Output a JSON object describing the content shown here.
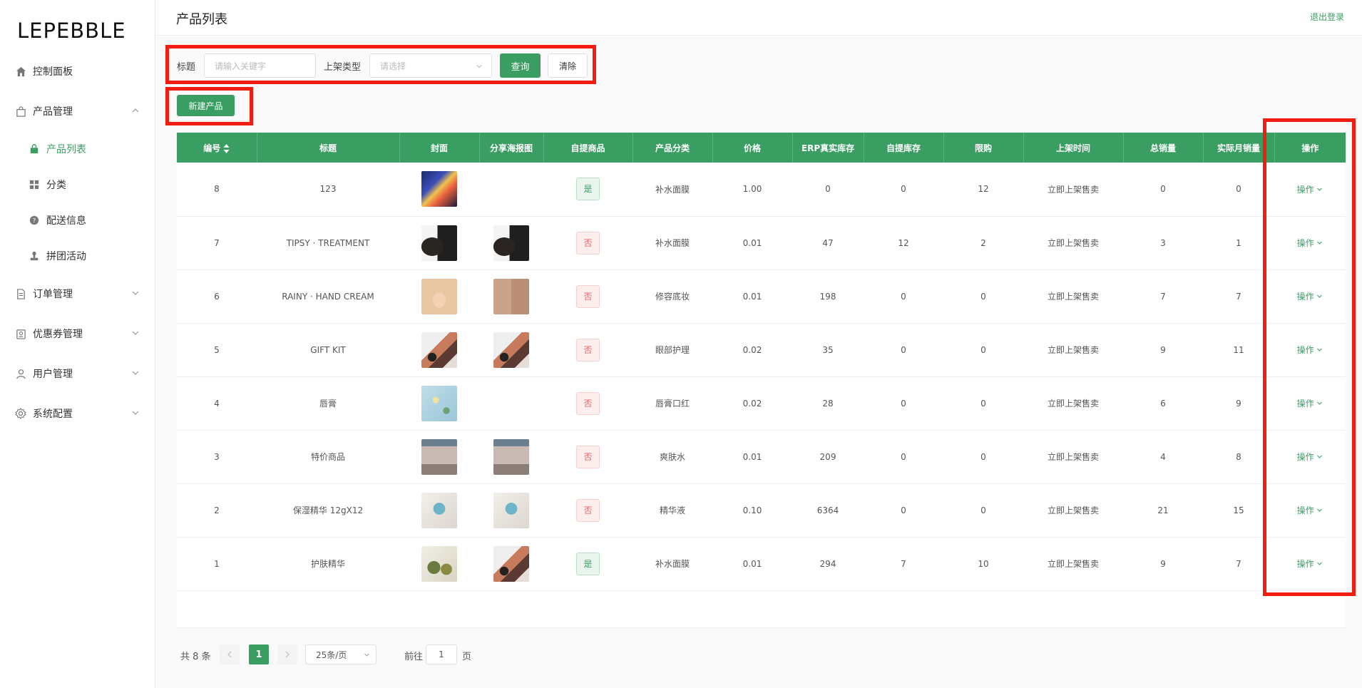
{
  "sidebar": {
    "logo": "LEPEBBLE",
    "items": [
      {
        "label": "控制面板",
        "icon": "home-icon"
      },
      {
        "label": "产品管理",
        "icon": "bag-icon"
      },
      {
        "label": "订单管理",
        "icon": "document-icon"
      },
      {
        "label": "优惠券管理",
        "icon": "coupon-icon"
      },
      {
        "label": "用户管理",
        "icon": "user-icon"
      },
      {
        "label": "系统配置",
        "icon": "gear-icon"
      }
    ],
    "sub_items": [
      {
        "label": "产品列表",
        "icon": "shopping-bag-icon",
        "active": true
      },
      {
        "label": "分类",
        "icon": "grid-icon"
      },
      {
        "label": "配送信息",
        "icon": "question-icon"
      },
      {
        "label": "拼团活动",
        "icon": "stamp-icon"
      }
    ]
  },
  "header": {
    "title": "产品列表",
    "logout": "退出登录"
  },
  "filter": {
    "title_label": "标题",
    "title_placeholder": "请输入关键字",
    "type_label": "上架类型",
    "type_placeholder": "请选择",
    "query_button": "查询",
    "clear_button": "清除"
  },
  "new_product_button": "新建产品",
  "table": {
    "headers": [
      "编号",
      "标题",
      "封面",
      "分享海报图",
      "自提商品",
      "产品分类",
      "价格",
      "ERP真实库存",
      "自提库存",
      "限购",
      "上架时间",
      "总销量",
      "实际月销量",
      "操作"
    ],
    "rows": [
      {
        "id": "8",
        "title": "123",
        "self_pickup": "是",
        "category": "补水面膜",
        "price": "1.00",
        "erp_stock": "0",
        "pickup_stock": "0",
        "limit": "12",
        "shelf_time": "立即上架售卖",
        "total_sales": "0",
        "monthly_sales": "0",
        "action": "操作",
        "cover": "comic",
        "poster": ""
      },
      {
        "id": "7",
        "title": "TIPSY · TREATMENT",
        "self_pickup": "否",
        "category": "补水面膜",
        "price": "0.01",
        "erp_stock": "47",
        "pickup_stock": "12",
        "limit": "2",
        "shelf_time": "立即上架售卖",
        "total_sales": "3",
        "monthly_sales": "1",
        "action": "操作",
        "cover": "bottle",
        "poster": "bottle"
      },
      {
        "id": "6",
        "title": "RAINY · HAND CREAM",
        "self_pickup": "否",
        "category": "修容底妆",
        "price": "0.01",
        "erp_stock": "198",
        "pickup_stock": "0",
        "limit": "0",
        "shelf_time": "立即上架售卖",
        "total_sales": "7",
        "monthly_sales": "7",
        "action": "操作",
        "cover": "cream",
        "poster": "people"
      },
      {
        "id": "5",
        "title": "GIFT KIT",
        "self_pickup": "否",
        "category": "眼部护理",
        "price": "0.02",
        "erp_stock": "35",
        "pickup_stock": "0",
        "limit": "0",
        "shelf_time": "立即上架售卖",
        "total_sales": "9",
        "monthly_sales": "11",
        "action": "操作",
        "cover": "palette",
        "poster": "palette"
      },
      {
        "id": "4",
        "title": "唇膏",
        "self_pickup": "否",
        "category": "唇膏口红",
        "price": "0.02",
        "erp_stock": "28",
        "pickup_stock": "0",
        "limit": "0",
        "shelf_time": "立即上架售卖",
        "total_sales": "6",
        "monthly_sales": "9",
        "action": "操作",
        "cover": "blue",
        "poster": ""
      },
      {
        "id": "3",
        "title": "特价商品",
        "self_pickup": "否",
        "category": "爽肤水",
        "price": "0.01",
        "erp_stock": "209",
        "pickup_stock": "0",
        "limit": "0",
        "shelf_time": "立即上架售卖",
        "total_sales": "4",
        "monthly_sales": "8",
        "action": "操作",
        "cover": "store",
        "poster": "store"
      },
      {
        "id": "2",
        "title": "保湿精华 12gX12",
        "self_pickup": "否",
        "category": "精华液",
        "price": "0.10",
        "erp_stock": "6364",
        "pickup_stock": "0",
        "limit": "0",
        "shelf_time": "立即上架售卖",
        "total_sales": "21",
        "monthly_sales": "15",
        "action": "操作",
        "cover": "hand",
        "poster": "hand"
      },
      {
        "id": "1",
        "title": "护肤精华",
        "self_pickup": "是",
        "category": "补水面膜",
        "price": "0.01",
        "erp_stock": "294",
        "pickup_stock": "7",
        "limit": "10",
        "shelf_time": "立即上架售卖",
        "total_sales": "9",
        "monthly_sales": "7",
        "action": "操作",
        "cover": "jars",
        "poster": "palette"
      }
    ]
  },
  "pagination": {
    "total": "共 8 条",
    "current_page": "1",
    "page_size": "25条/页",
    "goto_label": "前往",
    "goto_value": "1",
    "page_suffix": "页"
  },
  "colors": {
    "accent": "#3a9e63",
    "highlight": "#f01e0e",
    "tag_no": "#f06464"
  }
}
